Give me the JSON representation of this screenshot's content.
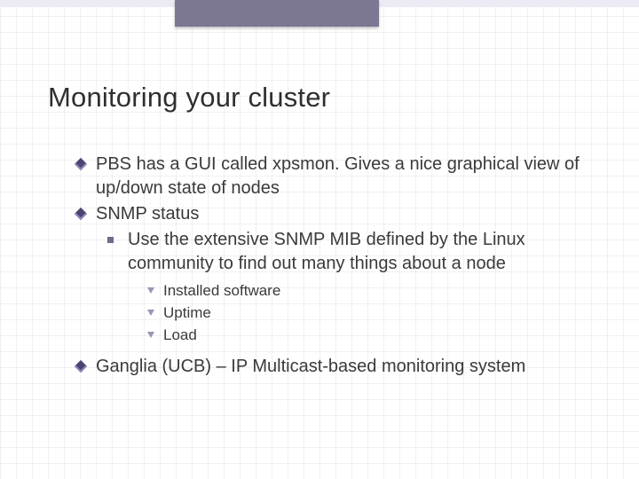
{
  "title": "Monitoring your cluster",
  "bullets": {
    "b1": "PBS has a GUI called xpsmon. Gives a nice graphical view of up/down state of nodes",
    "b2": "SNMP status",
    "b2_1": "Use the extensive SNMP MIB defined by the Linux community to find out many things about a node",
    "b2_1_1": "Installed software",
    "b2_1_2": "Uptime",
    "b2_1_3": "Load",
    "b3": "Ganglia (UCB) – IP Multicast-based monitoring system"
  }
}
